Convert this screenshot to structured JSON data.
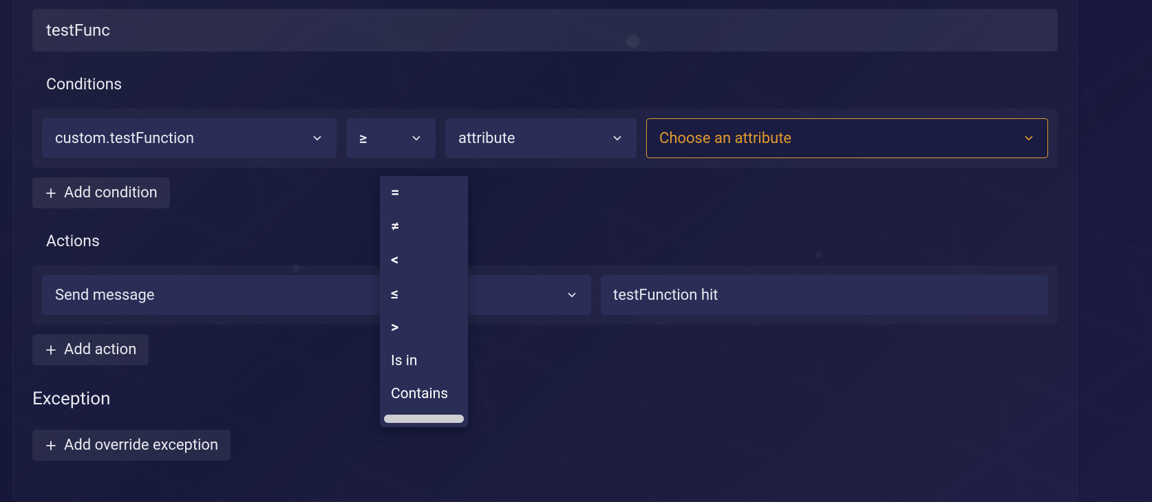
{
  "nameInput": {
    "value": "testFunc"
  },
  "sections": {
    "conditions": {
      "title": "Conditions"
    },
    "actions": {
      "title": "Actions"
    },
    "exception": {
      "title": "Exception"
    }
  },
  "condition": {
    "function_select": {
      "value": "custom.testFunction"
    },
    "operator_select": {
      "value": "≥"
    },
    "attrkind_select": {
      "value": "attribute"
    },
    "attribute_select": {
      "placeholder": "Choose an attribute"
    }
  },
  "operator_dropdown": {
    "options": [
      "=",
      "≠",
      "<",
      "≤",
      ">",
      "Is in",
      "Contains"
    ]
  },
  "action": {
    "type_select": {
      "value": "Send message"
    },
    "value_input": {
      "value": "testFunction hit"
    }
  },
  "buttons": {
    "add_condition": "Add condition",
    "add_action": "Add action",
    "add_override_exception": "Add override exception"
  },
  "colors": {
    "accent": "#e39a2e",
    "panel": "#2a2d56"
  }
}
